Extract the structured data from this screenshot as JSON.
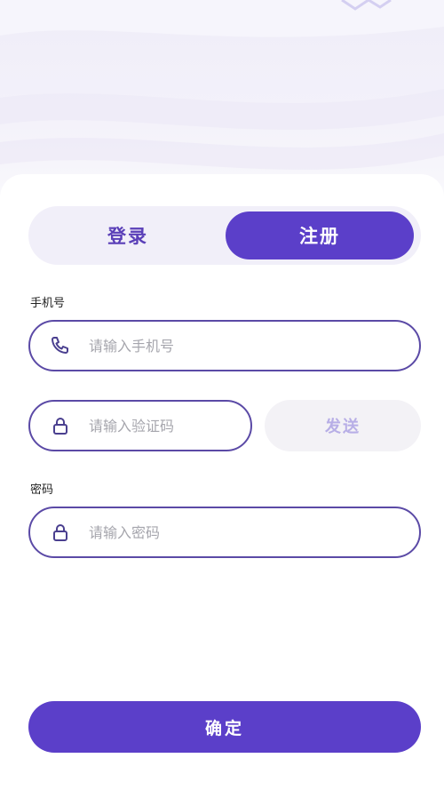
{
  "tabs": {
    "login_label": "登录",
    "register_label": "注册",
    "active": "register"
  },
  "phone": {
    "label": "手机号",
    "placeholder": "请输入手机号"
  },
  "code": {
    "placeholder": "请输入验证码",
    "send_label": "发送"
  },
  "password": {
    "label": "密码",
    "placeholder": "请输入密码"
  },
  "confirm_label": "确定",
  "colors": {
    "accent": "#5b3fc9",
    "field_border": "#5b4aa6",
    "send_text": "#b7aee6"
  },
  "icons": [
    "phone-icon",
    "lock-icon"
  ]
}
